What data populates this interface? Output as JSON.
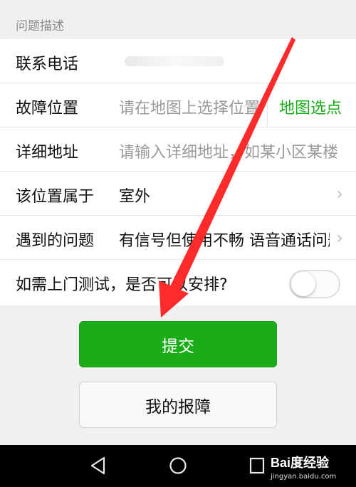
{
  "section": {
    "title": "问题描述"
  },
  "form": {
    "phone": {
      "label": "联系电话",
      "value": ""
    },
    "location": {
      "label": "故障位置",
      "placeholder": "请在地图上选择位置",
      "map_button": "地图选点"
    },
    "address": {
      "label": "详细地址",
      "placeholder": "请输入详细地址，如某小区某楼"
    },
    "belongs": {
      "label": "该位置属于",
      "value": "室外"
    },
    "problem": {
      "label": "遇到的问题",
      "value": "有信号但使用不畅 语音通话问题"
    },
    "visit": {
      "label": "如需上门测试，是否可以安排?",
      "toggle_on": false
    }
  },
  "buttons": {
    "submit": "提交",
    "my_reports": "我的报障"
  },
  "watermark": {
    "brand": "Bai度经验",
    "url": "jingyan.baidu.com"
  },
  "colors": {
    "accent": "#1aad19",
    "annotation_arrow": "#ff2a2a"
  }
}
